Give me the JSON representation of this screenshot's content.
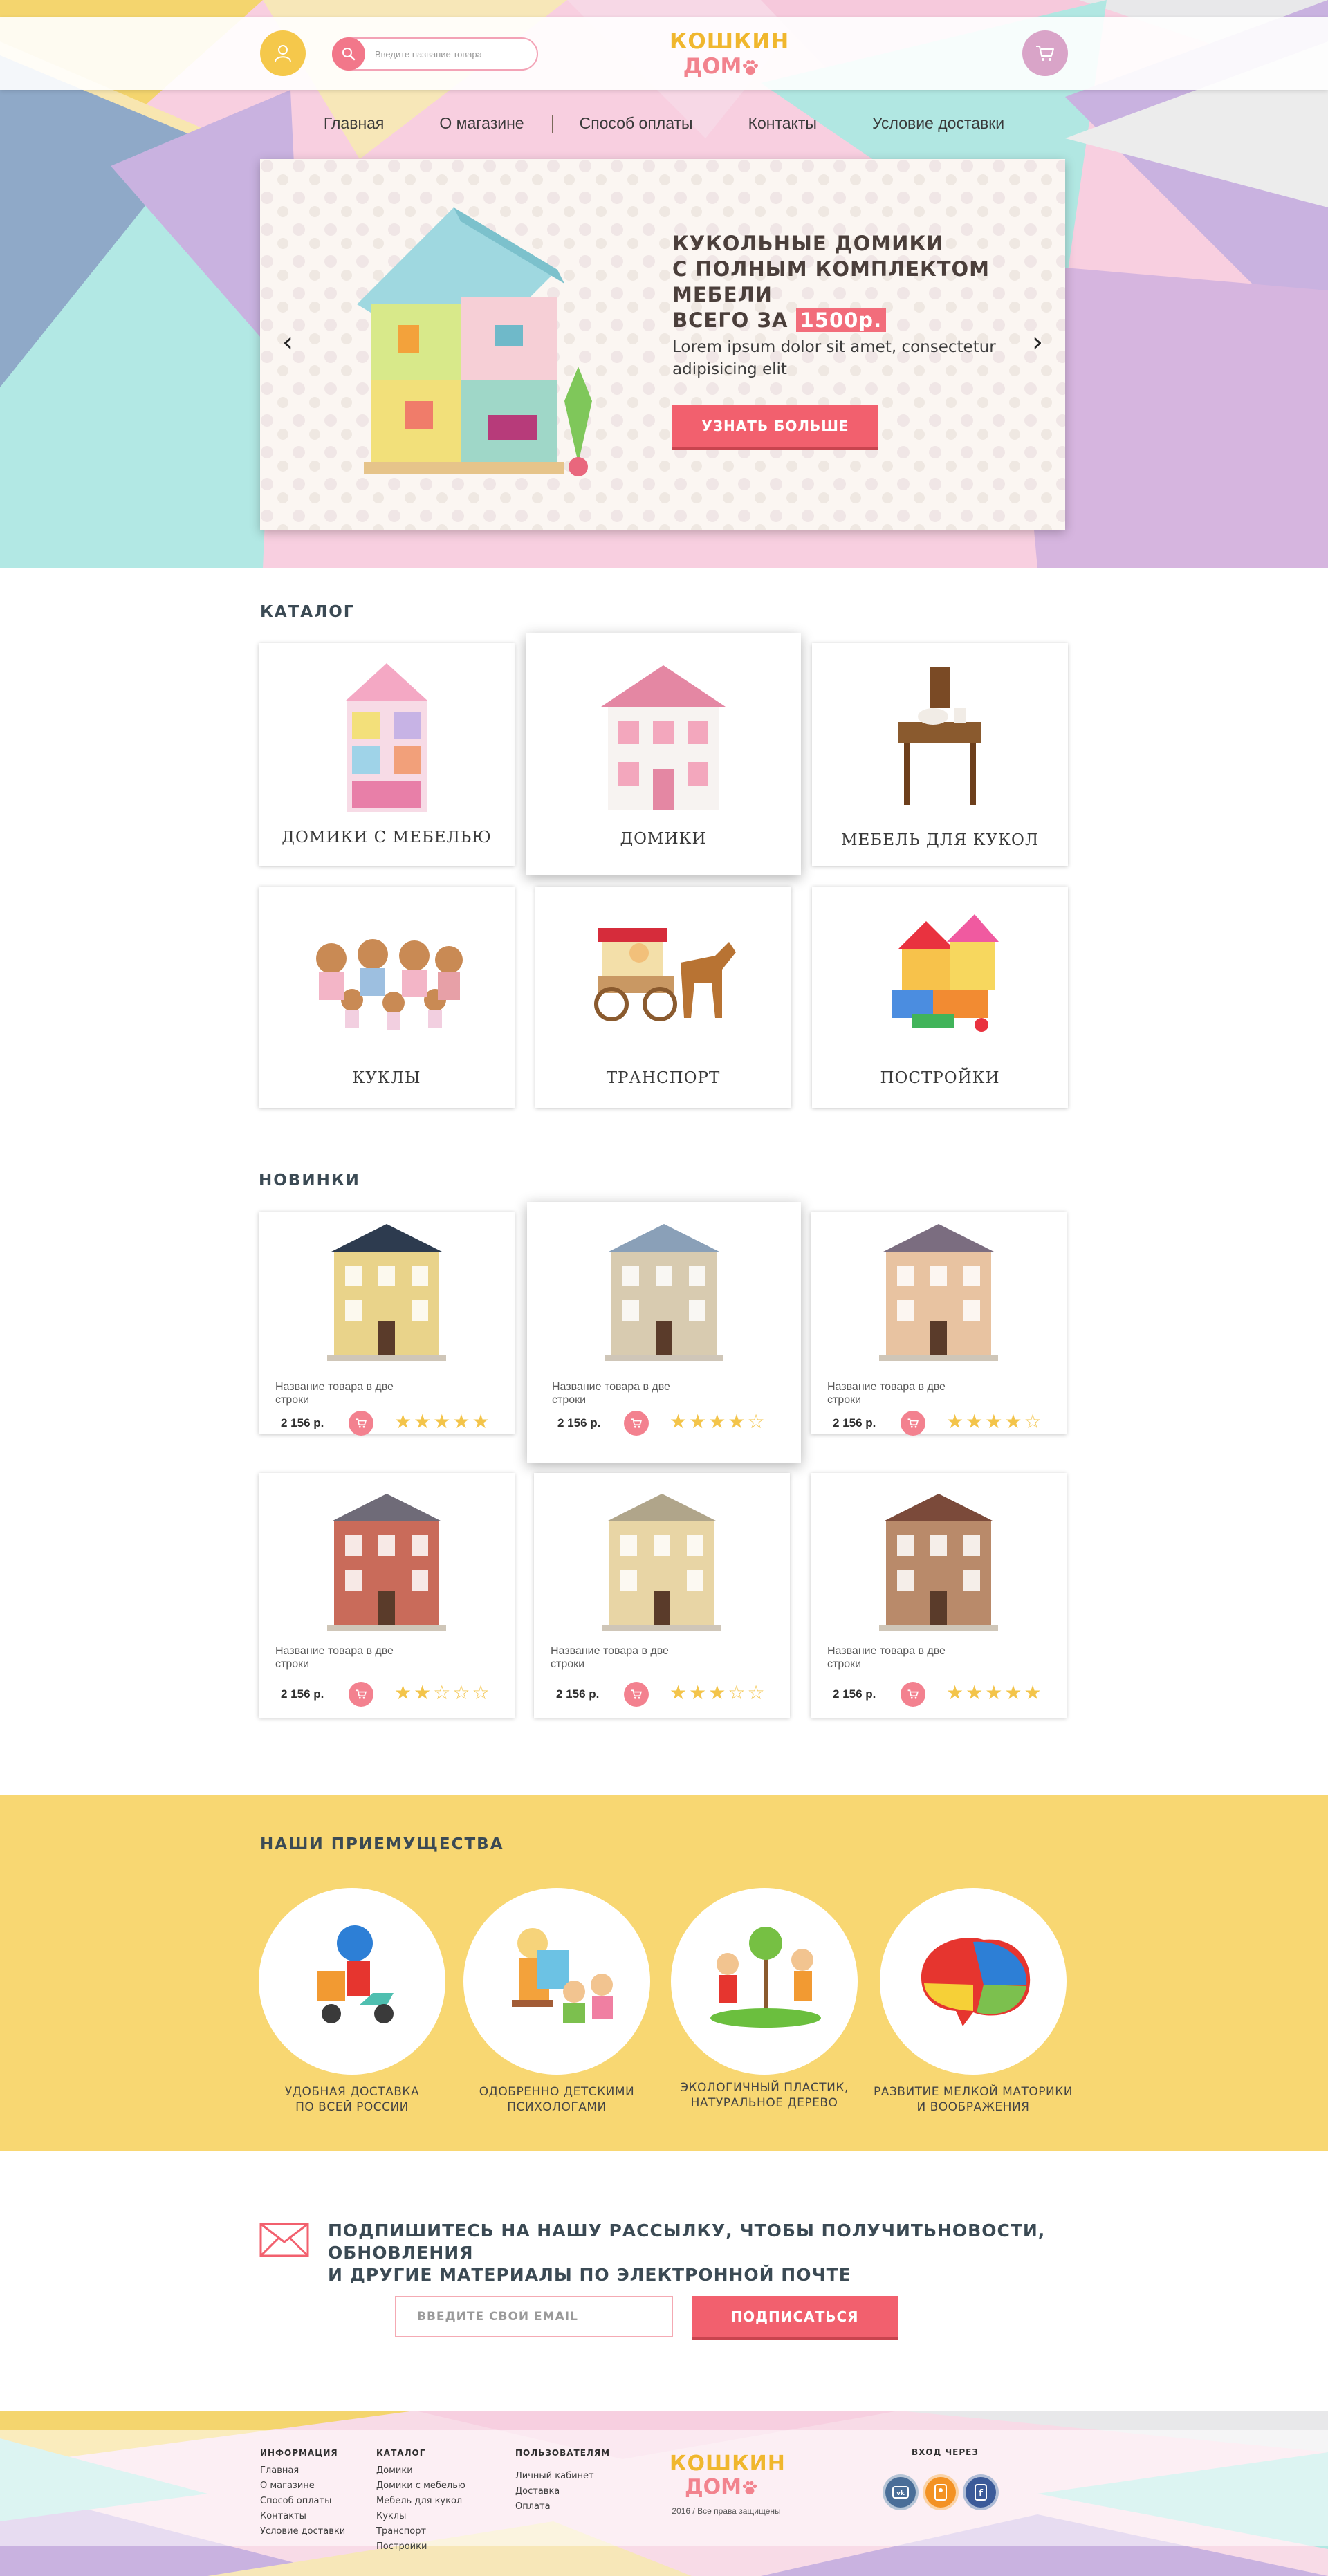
{
  "header": {
    "search_placeholder": "Введите название товара",
    "logo_line1": "КОШКИН",
    "logo_line2": "ДОМ"
  },
  "nav": [
    "Главная",
    "О магазине",
    "Способ оплаты",
    "Контакты",
    "Условие доставки"
  ],
  "slider": {
    "title_line1": "КУКОЛЬНЫЕ ДОМИКИ",
    "title_line2": "С ПОЛНЫМ КОМПЛЕКТОМ МЕБЕЛИ",
    "title_line3": "ВСЕГО ЗА",
    "price": "1500р.",
    "text": "Lorem ipsum dolor sit amet, consectetur adipisicing elit",
    "button": "УЗНАТЬ БОЛЬШЕ",
    "prev_icon": "chevron-left",
    "next_icon": "chevron-right"
  },
  "catalog": {
    "title": "КАТАЛОГ",
    "items": [
      {
        "label": "ДОМИКИ С МЕБЕЛЬЮ"
      },
      {
        "label": "ДОМИКИ"
      },
      {
        "label": "МЕБЕЛЬ ДЛЯ КУКОЛ"
      },
      {
        "label": "КУКЛЫ"
      },
      {
        "label": "ТРАНСПОРТ"
      },
      {
        "label": "ПОСТРОЙКИ"
      }
    ]
  },
  "new_items": {
    "title": "НОВИНКИ",
    "products": [
      {
        "name": "Название товара в две строки",
        "price": "2 156 р.",
        "rating": 5
      },
      {
        "name": "Название товара в две строки",
        "price": "2 156 р.",
        "rating": 4
      },
      {
        "name": "Название товара в две строки",
        "price": "2 156 р.",
        "rating": 4
      },
      {
        "name": "Название товара в две строки",
        "price": "2 156 р.",
        "rating": 2
      },
      {
        "name": "Название товара в две строки",
        "price": "2 156 р.",
        "rating": 3
      },
      {
        "name": "Название товара в две строки",
        "price": "2 156 р.",
        "rating": 5
      }
    ]
  },
  "advantages": {
    "title": "НАШИ ПРИЕМУЩЕСТВА",
    "items": [
      {
        "line1": "УДОБНАЯ ДОСТАВКА",
        "line2": "ПО ВСЕЙ РОССИИ"
      },
      {
        "line1": "ОДОБРЕННО ДЕТСКИМИ",
        "line2": "ПСИХОЛОГАМИ"
      },
      {
        "line1": "ЭКОЛОГИЧНЫЙ ПЛАСТИК,",
        "line2": "НАТУРАЛЬНОЕ ДЕРЕВО"
      },
      {
        "line1": "РАЗВИТИЕ МЕЛКОЙ МАТОРИКИ",
        "line2": "И ВООБРАЖЕНИЯ"
      }
    ]
  },
  "subscribe": {
    "title_line1": "ПОДПИШИТЕСЬ НА НАШУ РАССЫЛКУ, ЧТОБЫ ПОЛУЧИТЬНОВОСТИ, ОБНОВЛЕНИЯ",
    "title_line2": "И ДРУГИЕ МАТЕРИАЛЫ ПО ЭЛЕКТРОННОЙ ПОЧТЕ",
    "email_placeholder": "ВВЕДИТЕ СВОЙ EMAIL",
    "button": "ПОДПИСАТЬСЯ"
  },
  "footer": {
    "info": {
      "title": "ИНФОРМАЦИЯ",
      "links": [
        "Главная",
        "О магазине",
        "Способ оплаты",
        "Контакты",
        "Условие доставки"
      ]
    },
    "catalog": {
      "title": "КАТАЛОГ",
      "links": [
        "Домики",
        "Домики с мебелью",
        "Мебель для кукол",
        "Куклы",
        "Транспорт",
        "Постройки"
      ]
    },
    "users": {
      "title": "ПОЛЬЗОВАТЕЛЯМ",
      "links": [
        "Личный кабинет",
        "Доставка",
        "Оплата"
      ]
    },
    "logo_line1": "КОШКИН",
    "logo_line2": "ДОМ",
    "copyright": "2016 / Все права защищены",
    "social_title": "ВХОД ЧЕРЕЗ",
    "social": [
      {
        "icon": "vk-icon",
        "color": "#4a6e98"
      },
      {
        "icon": "ok-icon",
        "color": "#f39224"
      },
      {
        "icon": "facebook-icon",
        "color": "#3b5a99"
      }
    ]
  },
  "colors": {
    "accent_pink": "#f2606e",
    "accent_yellow": "#f8d772",
    "star": "#f3c44a"
  }
}
